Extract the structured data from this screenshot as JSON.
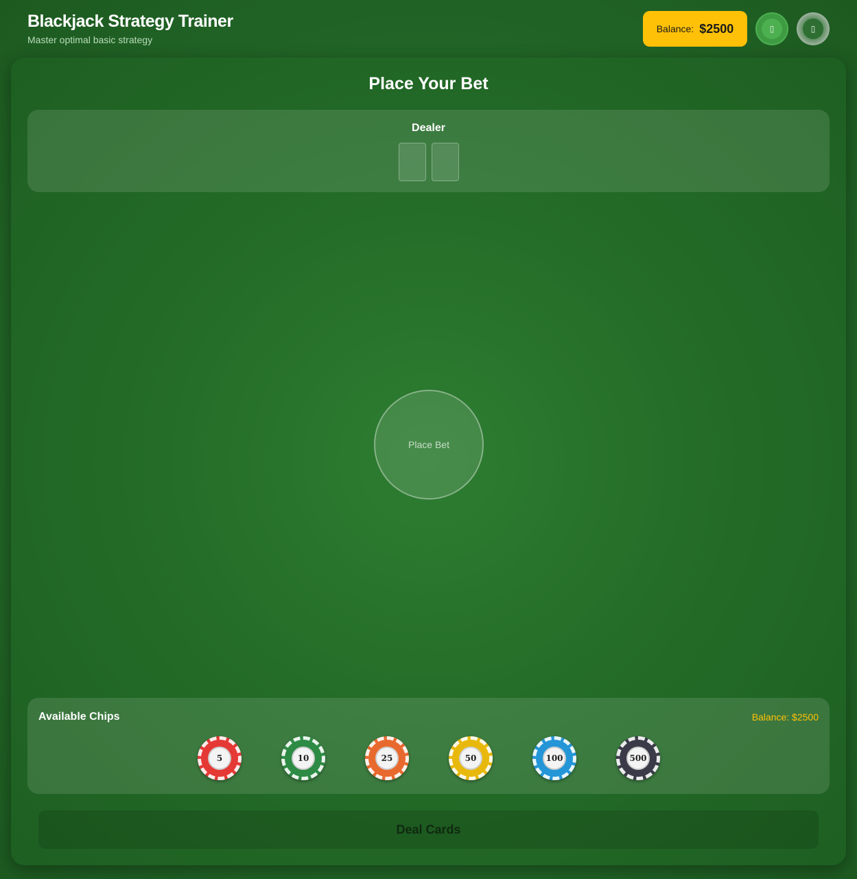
{
  "header": {
    "title": "Blackjack Strategy Trainer",
    "subtitle": "Master optimal basic strategy",
    "balance_label": "Balance:",
    "balance_value": "$2500",
    "buttons": [
      {
        "icon": "stats-icon",
        "glyph": "▯"
      },
      {
        "icon": "settings-icon",
        "glyph": "▯"
      }
    ]
  },
  "table": {
    "phase_title": "Place Your Bet",
    "dealer_label": "Dealer",
    "bet_circle_label": "Place Bet"
  },
  "chips": {
    "title": "Available Chips",
    "balance_text": "Balance: $2500",
    "items": [
      {
        "value": "5",
        "color": "#e53935"
      },
      {
        "value": "10",
        "color": "#2e8b45"
      },
      {
        "value": "25",
        "color": "#e8692e"
      },
      {
        "value": "50",
        "color": "#e8b90c"
      },
      {
        "value": "100",
        "color": "#2496d8"
      },
      {
        "value": "500",
        "color": "#3a3a48"
      }
    ]
  },
  "actions": {
    "deal_label": "Deal Cards"
  },
  "colors": {
    "felt": "#2e7d32",
    "accent": "#ffc107"
  }
}
